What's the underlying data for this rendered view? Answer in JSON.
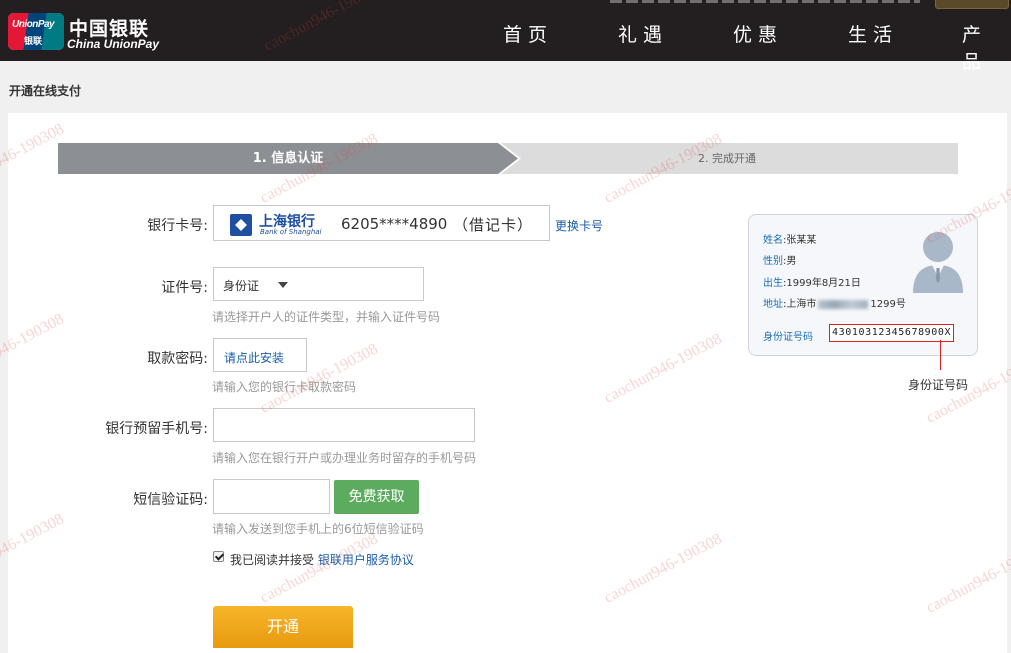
{
  "header": {
    "logo_badge_top": "UnionPay",
    "logo_badge_bottom": "银联",
    "logo_cn": "中国银联",
    "logo_en": "China UnionPay",
    "nav": [
      "首页",
      "礼遇",
      "优惠",
      "生活",
      "产品"
    ]
  },
  "page": {
    "title": "开通在线支付"
  },
  "steps": {
    "step1": "1. 信息认证",
    "step2": "2. 完成开通"
  },
  "form": {
    "bank_card_label": "银行卡号:",
    "bank_name_cn": "上海银行",
    "bank_name_en": "Bank of Shanghai",
    "card_number": "6205****4890",
    "card_type": "（借记卡）",
    "change_card": "更换卡号",
    "id_label": "证件号:",
    "id_type": "身份证",
    "id_hint": "请选择开户人的证件类型，并输入证件号码",
    "pin_label": "取款密码:",
    "pin_install": "请点此安装",
    "pin_hint": "请输入您的银行卡取款密码",
    "phone_label": "银行预留手机号:",
    "phone_hint": "请输入您在银行开户或办理业务时留存的手机号码",
    "sms_label": "短信验证码:",
    "sms_button": "免费获取",
    "sms_hint": "请输入发送到您手机上的6位短信验证码",
    "agree_text": "我已阅读并接受",
    "agree_link": "银联用户服务协议",
    "submit": "开通"
  },
  "idcard": {
    "name_key": "姓名",
    "name_val": "张某某",
    "gender_key": "性别",
    "gender_val": "男",
    "birth_key": "出生",
    "birth_val": "1999年8月21日",
    "addr_key": "地址",
    "addr_prefix": "上海市",
    "addr_suffix": "1299号",
    "num_key": "身份证号码",
    "num_val": "43010312345678900X",
    "pointer_label": "身份证号码"
  },
  "watermark": "caochun946-190308",
  "colors": {
    "header_bg": "#231f20",
    "step_active": "#8c8f93",
    "sms_green": "#5dab5f",
    "submit_orange": "#f0a81c",
    "link_blue": "#1a5ea8"
  }
}
